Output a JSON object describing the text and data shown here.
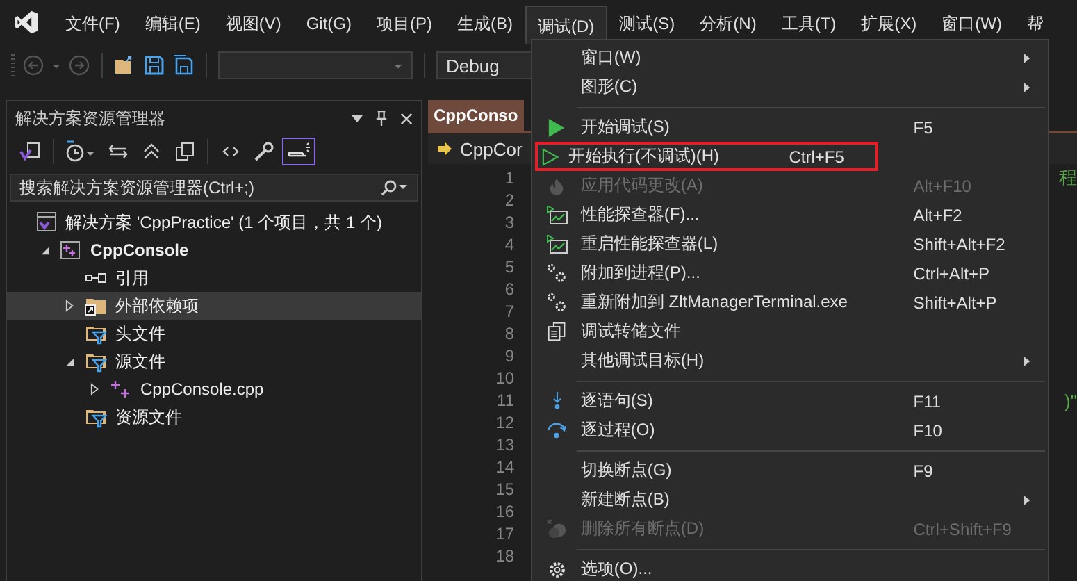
{
  "menu_bar": [
    {
      "label": "文件(F)",
      "selected": false
    },
    {
      "label": "编辑(E)",
      "selected": false
    },
    {
      "label": "视图(V)",
      "selected": false
    },
    {
      "label": "Git(G)",
      "selected": false
    },
    {
      "label": "项目(P)",
      "selected": false
    },
    {
      "label": "生成(B)",
      "selected": false
    },
    {
      "label": "调试(D)",
      "selected": true
    },
    {
      "label": "测试(S)",
      "selected": false
    },
    {
      "label": "分析(N)",
      "selected": false
    },
    {
      "label": "工具(T)",
      "selected": false
    },
    {
      "label": "扩展(X)",
      "selected": false
    },
    {
      "label": "窗口(W)",
      "selected": false
    },
    {
      "label": "帮",
      "selected": false
    }
  ],
  "toolbar": {
    "configuration": "Debug"
  },
  "solution_explorer": {
    "title": "解决方案资源管理器",
    "toolbar": [
      {
        "selected": false
      },
      {
        "selected": false
      },
      {
        "selected": false
      },
      {
        "selected": false
      },
      {
        "selected": false
      },
      {
        "selected": false
      },
      {
        "selected": false
      },
      {
        "selected": true
      }
    ],
    "search": {
      "placeholder": "搜索解决方案资源管理器(Ctrl+;)"
    },
    "tree": [
      {
        "kind": "solution",
        "label": "解决方案 'CppPractice' (1 个项目，共 1 个)",
        "selected": false,
        "children": [
          {
            "kind": "project",
            "label": "CppConsole",
            "expanded": true,
            "selected": false,
            "children": [
              {
                "kind": "references",
                "label": "引用",
                "selected": false
              },
              {
                "kind": "external",
                "label": "外部依赖项",
                "expanded": false,
                "selected": true
              },
              {
                "kind": "filter",
                "label": "头文件",
                "selected": false
              },
              {
                "kind": "filter",
                "label": "源文件",
                "expanded": true,
                "selected": false,
                "children": [
                  {
                    "kind": "file",
                    "label": "CppConsole.cpp",
                    "expanded": false,
                    "selected": false
                  }
                ]
              },
              {
                "kind": "filter",
                "label": "资源文件",
                "selected": false
              }
            ]
          }
        ]
      }
    ]
  },
  "editor": {
    "tab": "CppConso",
    "nav": "CppCor",
    "lines": [
      {
        "number": "1",
        "code": "程"
      },
      {
        "number": "2"
      },
      {
        "number": "3"
      },
      {
        "number": "4"
      },
      {
        "number": "5"
      },
      {
        "number": "6"
      },
      {
        "number": "7"
      },
      {
        "number": "8"
      },
      {
        "number": "9"
      },
      {
        "number": "10"
      },
      {
        "number": "11",
        "code": ")\""
      },
      {
        "number": "12"
      },
      {
        "number": "13"
      },
      {
        "number": "14"
      },
      {
        "number": "15"
      },
      {
        "number": "16"
      },
      {
        "number": "17"
      },
      {
        "number": "18"
      }
    ]
  },
  "debug_menu": [
    {
      "kind": "item",
      "label": "窗口(W)",
      "submenu": true,
      "disabled": false,
      "annotated": false
    },
    {
      "kind": "item",
      "label": "图形(C)",
      "submenu": true,
      "disabled": false,
      "annotated": false
    },
    {
      "kind": "separator"
    },
    {
      "kind": "item",
      "label": "开始调试(S)",
      "shortcut": "F5",
      "submenu": false,
      "disabled": false,
      "annotated": false
    },
    {
      "kind": "item",
      "label": "开始执行(不调试)(H)",
      "shortcut": "Ctrl+F5",
      "submenu": false,
      "disabled": false,
      "annotated": true
    },
    {
      "kind": "item",
      "label": "应用代码更改(A)",
      "shortcut": "Alt+F10",
      "submenu": false,
      "disabled": true,
      "annotated": false
    },
    {
      "kind": "item",
      "label": "性能探查器(F)...",
      "shortcut": "Alt+F2",
      "submenu": false,
      "disabled": false,
      "annotated": false
    },
    {
      "kind": "item",
      "label": "重启性能探查器(L)",
      "shortcut": "Shift+Alt+F2",
      "submenu": false,
      "disabled": false,
      "annotated": false
    },
    {
      "kind": "item",
      "label": "附加到进程(P)...",
      "shortcut": "Ctrl+Alt+P",
      "submenu": false,
      "disabled": false,
      "annotated": false
    },
    {
      "kind": "item",
      "label": "重新附加到 ZltManagerTerminal.exe",
      "shortcut": "Shift+Alt+P",
      "submenu": false,
      "disabled": false,
      "annotated": false
    },
    {
      "kind": "item",
      "label": "调试转储文件",
      "submenu": false,
      "disabled": false,
      "annotated": false
    },
    {
      "kind": "item",
      "label": "其他调试目标(H)",
      "submenu": true,
      "disabled": false,
      "annotated": false
    },
    {
      "kind": "separator"
    },
    {
      "kind": "item",
      "label": "逐语句(S)",
      "shortcut": "F11",
      "submenu": false,
      "disabled": false,
      "annotated": false
    },
    {
      "kind": "item",
      "label": "逐过程(O)",
      "shortcut": "F10",
      "submenu": false,
      "disabled": false,
      "annotated": false
    },
    {
      "kind": "separator"
    },
    {
      "kind": "item",
      "label": "切换断点(G)",
      "shortcut": "F9",
      "submenu": false,
      "disabled": false,
      "annotated": false
    },
    {
      "kind": "item",
      "label": "新建断点(B)",
      "submenu": true,
      "disabled": false,
      "annotated": false
    },
    {
      "kind": "item",
      "label": "删除所有断点(D)",
      "shortcut": "Ctrl+Shift+F9",
      "submenu": false,
      "disabled": true,
      "annotated": false
    },
    {
      "kind": "separator"
    },
    {
      "kind": "item",
      "label": "选项(O)...",
      "submenu": false,
      "disabled": false,
      "annotated": false
    }
  ]
}
